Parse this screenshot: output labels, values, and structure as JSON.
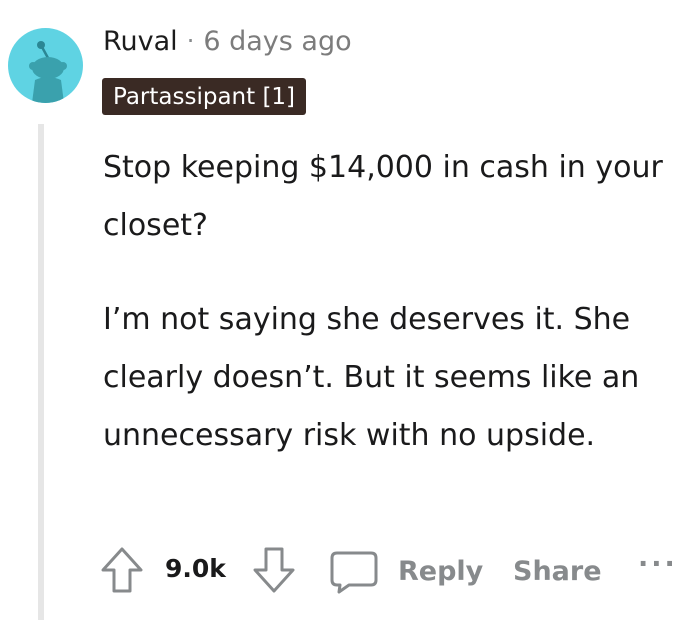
{
  "comment": {
    "author": "Ruval",
    "separator": "·",
    "timestamp": "6 days ago",
    "flair": "Partassipant [1]",
    "paragraphs": [
      "Stop keeping $14,000 in cash in your closet?",
      "I’m not saying she deserves it. She clearly doesn’t. But it seems like an unnecessary risk with no upside."
    ]
  },
  "actions": {
    "score": "9.0k",
    "reply_label": "Reply",
    "share_label": "Share",
    "more_label": "···"
  },
  "icons": {
    "avatar": "snoo-avatar-icon",
    "upvote": "upvote-arrow-icon",
    "downvote": "downvote-arrow-icon",
    "comment": "comment-bubble-icon"
  },
  "colors": {
    "avatar_bg": "#5fd3e3",
    "flair_bg": "#3a2a24",
    "muted_text": "#878a8c",
    "thread_line": "#e6e6e6"
  }
}
